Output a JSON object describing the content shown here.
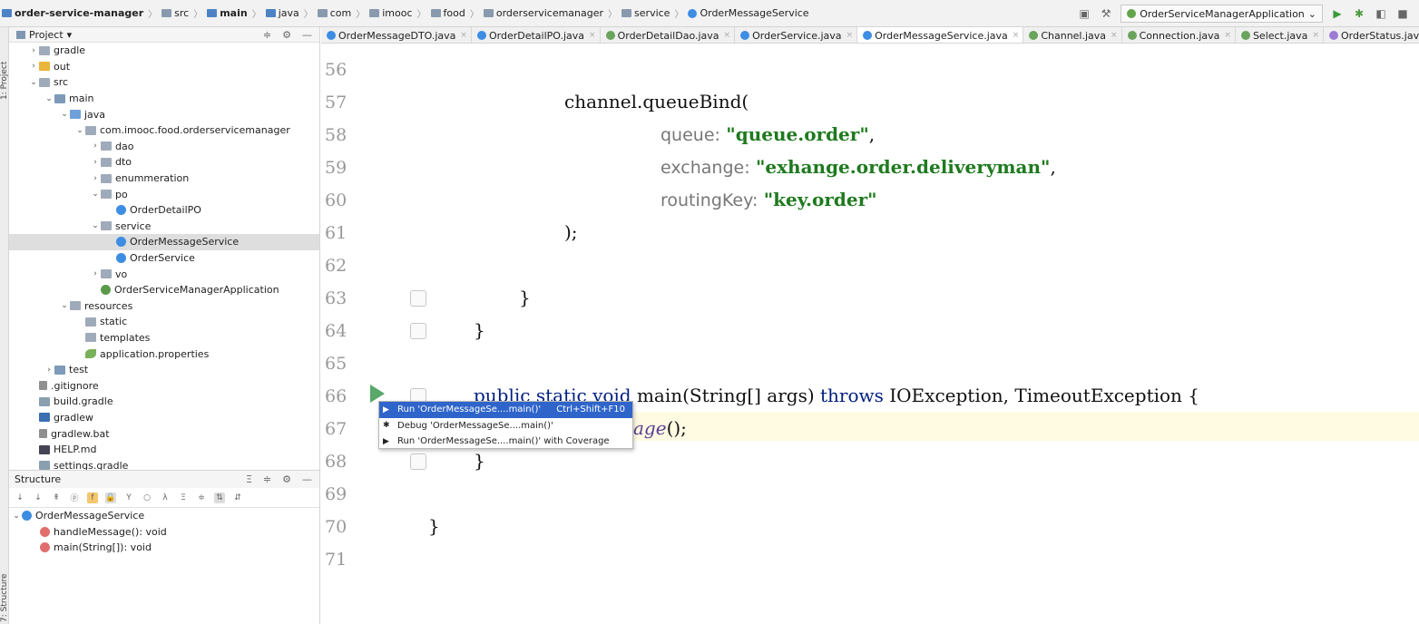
{
  "breadcrumb": [
    "order-service-manager",
    "src",
    "main",
    "java",
    "com",
    "imooc",
    "food",
    "orderservicemanager",
    "service",
    "OrderMessageService"
  ],
  "run_config": "OrderServiceManagerApplication",
  "left_strip": {
    "project": "1: Project",
    "structure": "7: Structure"
  },
  "project_panel": {
    "title": "Project",
    "tree": [
      {
        "label": "gradle",
        "depth": 1,
        "arrow": "›",
        "icon": "folder"
      },
      {
        "label": "out",
        "depth": 1,
        "arrow": "›",
        "icon": "orange"
      },
      {
        "label": "src",
        "depth": 1,
        "arrow": "⌄",
        "icon": "folder"
      },
      {
        "label": "main",
        "depth": 2,
        "arrow": "⌄",
        "icon": "src"
      },
      {
        "label": "java",
        "depth": 3,
        "arrow": "⌄",
        "icon": "blue"
      },
      {
        "label": "com.imooc.food.orderservicemanager",
        "depth": 4,
        "arrow": "⌄",
        "icon": "folder"
      },
      {
        "label": "dao",
        "depth": 5,
        "arrow": "›",
        "icon": "folder"
      },
      {
        "label": "dto",
        "depth": 5,
        "arrow": "›",
        "icon": "folder"
      },
      {
        "label": "enummeration",
        "depth": 5,
        "arrow": "›",
        "icon": "folder"
      },
      {
        "label": "po",
        "depth": 5,
        "arrow": "⌄",
        "icon": "folder"
      },
      {
        "label": "OrderDetailPO",
        "depth": 6,
        "arrow": "",
        "icon": "cls"
      },
      {
        "label": "service",
        "depth": 5,
        "arrow": "⌄",
        "icon": "folder"
      },
      {
        "label": "OrderMessageService",
        "depth": 6,
        "arrow": "",
        "icon": "cls",
        "selected": true
      },
      {
        "label": "OrderService",
        "depth": 6,
        "arrow": "",
        "icon": "cls"
      },
      {
        "label": "vo",
        "depth": 5,
        "arrow": "›",
        "icon": "folder"
      },
      {
        "label": "OrderServiceManagerApplication",
        "depth": 5,
        "arrow": "",
        "icon": "app"
      },
      {
        "label": "resources",
        "depth": 3,
        "arrow": "⌄",
        "icon": "folder"
      },
      {
        "label": "static",
        "depth": 4,
        "arrow": "",
        "icon": "folder"
      },
      {
        "label": "templates",
        "depth": 4,
        "arrow": "",
        "icon": "folder"
      },
      {
        "label": "application.properties",
        "depth": 4,
        "arrow": "",
        "icon": "leaf"
      },
      {
        "label": "test",
        "depth": 2,
        "arrow": "›",
        "icon": "src"
      },
      {
        "label": ".gitignore",
        "depth": 1,
        "arrow": "",
        "icon": "file"
      },
      {
        "label": "build.gradle",
        "depth": 1,
        "arrow": "",
        "icon": "gradle"
      },
      {
        "label": "gradlew",
        "depth": 1,
        "arrow": "",
        "icon": "term"
      },
      {
        "label": "gradlew.bat",
        "depth": 1,
        "arrow": "",
        "icon": "file"
      },
      {
        "label": "HELP.md",
        "depth": 1,
        "arrow": "",
        "icon": "md"
      },
      {
        "label": "settings.gradle",
        "depth": 1,
        "arrow": "",
        "icon": "gradle"
      }
    ]
  },
  "structure_panel": {
    "title": "Structure",
    "items": [
      {
        "label": "OrderMessageService",
        "depth": 0,
        "icon": "cls"
      },
      {
        "label": "handleMessage(): void",
        "depth": 1,
        "icon": "method"
      },
      {
        "label": "main(String[]): void",
        "depth": 1,
        "icon": "method"
      }
    ]
  },
  "tabs": [
    {
      "label": "OrderMessageDTO.java",
      "kind": "c"
    },
    {
      "label": "OrderDetailPO.java",
      "kind": "c"
    },
    {
      "label": "OrderDetailDao.java",
      "kind": "i"
    },
    {
      "label": "OrderService.java",
      "kind": "c"
    },
    {
      "label": "OrderMessageService.java",
      "kind": "c",
      "active": true
    },
    {
      "label": "Channel.java",
      "kind": "i"
    },
    {
      "label": "Connection.java",
      "kind": "i"
    },
    {
      "label": "Select.java",
      "kind": "i"
    },
    {
      "label": "OrderStatus.java",
      "kind": "e"
    }
  ],
  "editor": {
    "line_numbers": [
      "56",
      "57",
      "58",
      "59",
      "60",
      "61",
      "62",
      "63",
      "64",
      "65",
      "66",
      "67",
      "68",
      "69",
      "70",
      "71"
    ],
    "line57": "channel.queueBind(",
    "line58_param": "queue:",
    "line58_value": "\"queue.order\"",
    "line58_end": ",",
    "line59_param": "exchange:",
    "line59_value": "\"exhange.order.deliveryman\"",
    "line59_end": ",",
    "line60_param": "routingKey:",
    "line60_value": "\"key.order\"",
    "line61": ");",
    "line63": "}",
    "line64": "}",
    "line66_a": "public static ",
    "line66_kw1": "void",
    "line66_b": " main(String[] args) ",
    "line66_kw2": "throws",
    "line66_c": " IOException, TimeoutException {",
    "line67_ital": "age",
    "line67_end": "();",
    "line68": "}",
    "line70": "}"
  },
  "popup": {
    "items": [
      {
        "label": "Run 'OrderMessageSe....main()'",
        "shortcut": "Ctrl+Shift+F10",
        "icon": "▶"
      },
      {
        "label": "Debug 'OrderMessageSe....main()'",
        "shortcut": "",
        "icon": "✱"
      },
      {
        "label": "Run 'OrderMessageSe....main()' with Coverage",
        "shortcut": "",
        "icon": "▶"
      }
    ]
  },
  "colors": {
    "accent": "#2f65ca",
    "string": "#1f7a1f",
    "keyword": "#001f80",
    "run": "#59a869"
  }
}
